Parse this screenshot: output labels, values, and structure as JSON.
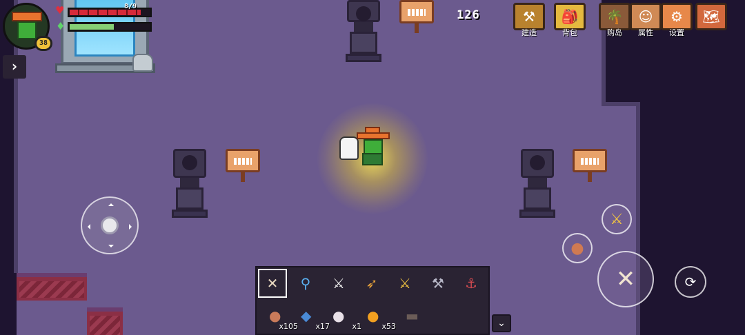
{
  "player": {
    "level": "38",
    "hp_text": "8/9",
    "hp_fraction": 0.89,
    "energy_fraction": 0.55
  },
  "currency": {
    "gold": "126"
  },
  "menu": [
    {
      "name": "build-button",
      "label": "建造",
      "icon": "hammer-anvil-icon",
      "glyph": "⚒",
      "bg": "#b9822e"
    },
    {
      "name": "backpack-button",
      "label": "背包",
      "icon": "backpack-icon",
      "glyph": "🎒",
      "bg": "#e5b93f"
    },
    {
      "name": "shop-island-button",
      "label": "购岛",
      "icon": "island-icon",
      "glyph": "🌴",
      "bg": "#8a5a39"
    },
    {
      "name": "attributes-button",
      "label": "属性",
      "icon": "character-icon",
      "glyph": "☺",
      "bg": "#d08a55"
    },
    {
      "name": "settings-button",
      "label": "设置",
      "icon": "gear-icon",
      "glyph": "⚙",
      "bg": "#e7884a"
    },
    {
      "name": "map-button",
      "label": "",
      "icon": "scroll-map-icon",
      "glyph": "🗺",
      "bg": "#d2683d"
    }
  ],
  "hotbar": {
    "tools": [
      {
        "name": "crossbow-slot",
        "icon": "crossbow-icon",
        "glyph": "✕",
        "color": "#e8d8c0",
        "selected": true
      },
      {
        "name": "shovel-slot",
        "icon": "shovel-icon",
        "glyph": "⚲",
        "color": "#5ab0f0",
        "selected": false
      },
      {
        "name": "sword-slot",
        "icon": "sword-icon",
        "glyph": "⚔",
        "color": "#f0f0f0",
        "selected": false
      },
      {
        "name": "bow-slot",
        "icon": "bow-icon",
        "glyph": "➶",
        "color": "#e8a23a",
        "selected": false
      },
      {
        "name": "golden-sword-slot",
        "icon": "golden-sword-icon",
        "glyph": "⚔",
        "color": "#f2c440",
        "selected": false
      },
      {
        "name": "hammer-slot",
        "icon": "hammer-icon",
        "glyph": "⚒",
        "color": "#b8b8c8",
        "selected": false
      },
      {
        "name": "fishing-rod-slot",
        "icon": "fishing-rod-icon",
        "glyph": "⚓",
        "color": "#d24a50",
        "selected": false
      }
    ],
    "items": [
      {
        "name": "meat-item",
        "icon": "meat-icon",
        "glyph": "●",
        "color": "#c97a5a",
        "qty": "x105"
      },
      {
        "name": "fish-item",
        "icon": "fish-icon",
        "glyph": "◆",
        "color": "#4a8ad6",
        "qty": "x17"
      },
      {
        "name": "radish-item",
        "icon": "radish-icon",
        "glyph": "●",
        "color": "#e8e0e8",
        "qty": "x1"
      },
      {
        "name": "orange-item",
        "icon": "orange-icon",
        "glyph": "●",
        "color": "#f2a020",
        "qty": "x53"
      },
      {
        "name": "sign-item",
        "icon": "sign-icon",
        "glyph": "▬",
        "color": "#6b5c58",
        "qty": ""
      }
    ]
  },
  "actions": {
    "attack_icon": "crossbow-icon",
    "dodge_icon": "dodge-roll-icon",
    "quick_weapon_icon": "golden-sword-icon",
    "quick_food_icon": "meat-icon"
  }
}
